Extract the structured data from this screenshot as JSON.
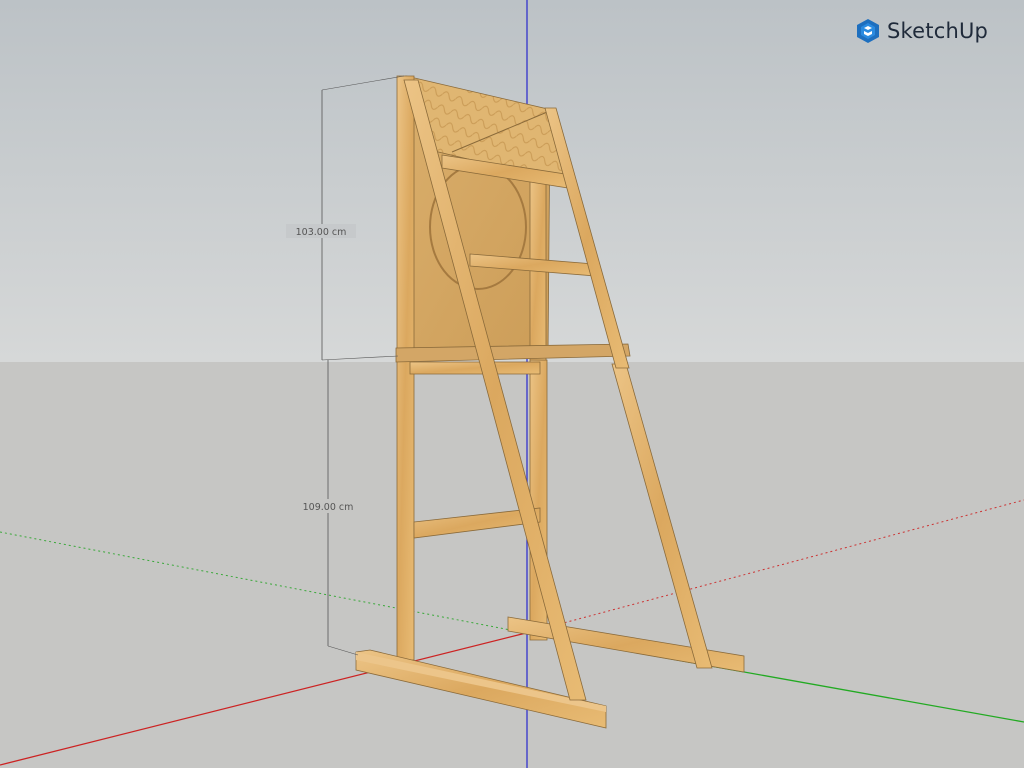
{
  "app": {
    "name": "SketchUp",
    "logo_icon": "sketchup-logo-icon"
  },
  "scene": {
    "background_sky": "#c4c8ca",
    "background_ground": "#c6c6c4",
    "wood_color": "#e2b46c",
    "axis_red": "#cc2222",
    "axis_green": "#22aa22",
    "axis_blue": "#3333cc"
  },
  "dimensions": {
    "upper": "103.00 cm",
    "lower": "109.00 cm"
  }
}
